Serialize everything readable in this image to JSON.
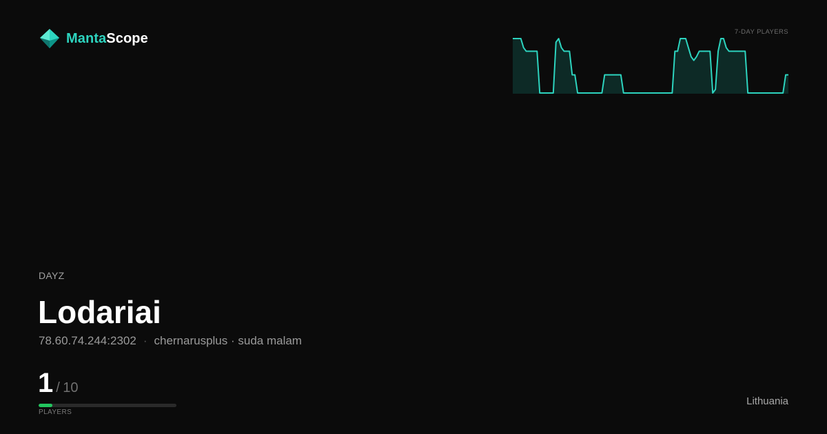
{
  "brand": {
    "name_a": "Manta",
    "name_b": "Scope",
    "icon": "manta-logo-icon",
    "accent": "#2dd4bf"
  },
  "server": {
    "game": "DAYZ",
    "name": "Lodariai",
    "address": "78.60.74.244:2302",
    "separator": "·",
    "description": "chernarusplus · suda malam",
    "players": "1",
    "players_sep": "/",
    "max_players": "10",
    "players_label": "PLAYERS",
    "player_fraction": 0.1,
    "location": "Lithuania"
  },
  "chart_data": {
    "type": "area",
    "title": "7-DAY PLAYERS",
    "color": "#2dd4bf",
    "fill": "#0d2a26",
    "ylim": [
      0,
      3
    ],
    "values": [
      3,
      3,
      3,
      3,
      2.5,
      2.3,
      2.3,
      2.3,
      2.3,
      2.3,
      0,
      0,
      0,
      0,
      0,
      0,
      2.8,
      3,
      2.5,
      2.3,
      2.3,
      2.3,
      1,
      1,
      0,
      0,
      0,
      0,
      0,
      0,
      0,
      0,
      0,
      0,
      1,
      1,
      1,
      1,
      1,
      1,
      1,
      0,
      0,
      0,
      0,
      0,
      0,
      0,
      0,
      0,
      0,
      0,
      0,
      0,
      0,
      0,
      0,
      0,
      0,
      0,
      2.3,
      2.3,
      3,
      3,
      3,
      2.5,
      2,
      1.8,
      2,
      2.3,
      2.3,
      2.3,
      2.3,
      2.3,
      0,
      0.2,
      2.3,
      3,
      3,
      2.5,
      2.3,
      2.3,
      2.3,
      2.3,
      2.3,
      2.3,
      2.3,
      0,
      0,
      0,
      0,
      0,
      0,
      0,
      0,
      0,
      0,
      0,
      0,
      0,
      0,
      1,
      1
    ]
  }
}
